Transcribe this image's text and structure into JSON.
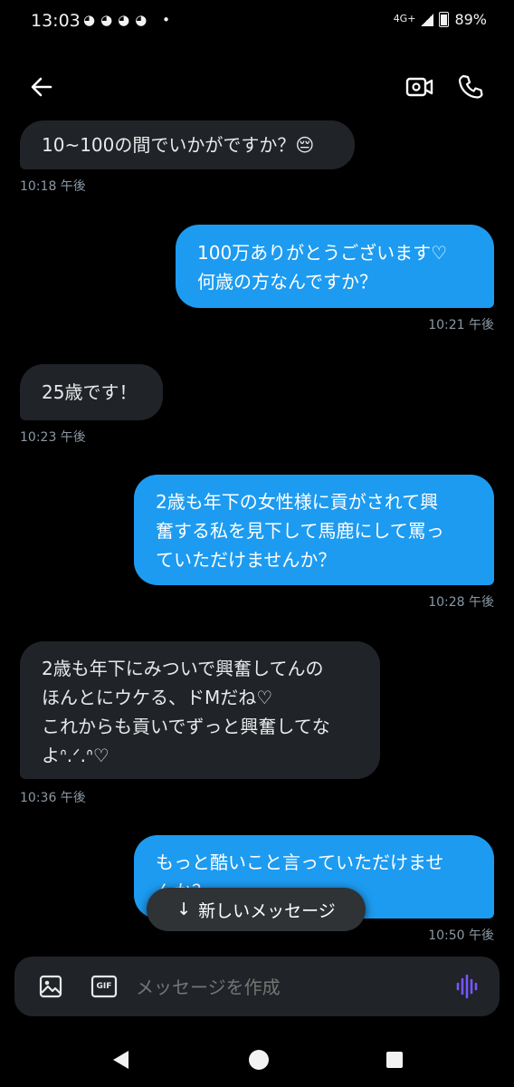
{
  "status": {
    "time": "13:03",
    "notif_icons": "◕◕◕◕ •",
    "network": "4G+",
    "battery": "89%"
  },
  "messages": [
    {
      "id": "m1",
      "side": "in",
      "lines": [
        "10~100の間でいかがですか？😔"
      ],
      "time": "10:18 午後"
    },
    {
      "id": "m2",
      "side": "out",
      "lines": [
        "100万ありがとうございます♡",
        "何歳の方なんですか？"
      ],
      "time": "10:21 午後"
    },
    {
      "id": "m3",
      "side": "in",
      "lines": [
        "25歳です！"
      ],
      "time": "10:23 午後"
    },
    {
      "id": "m4",
      "side": "out",
      "lines": [
        "2歳も年下の女性様に貢がされて興",
        "奮する私を見下して馬鹿にして罵っ",
        "ていただけませんか？"
      ],
      "time": "10:28 午後"
    },
    {
      "id": "m5",
      "side": "in",
      "lines": [
        "2歳も年下にみついで興奮してんの",
        "ほんとにウケる、ドMだね♡",
        "これからも貢いでずっと興奮してな",
        "よᐢ.ᐟ.ᐢ♡"
      ],
      "time": "10:36 午後"
    },
    {
      "id": "m6",
      "side": "out",
      "lines": [
        "もっと酷いこと言っていただけませ",
        "んか？"
      ],
      "time": "10:50 午後"
    }
  ],
  "new_messages_pill": {
    "arrow": "↓",
    "label": "新しいメッセージ"
  },
  "composer": {
    "placeholder": "メッセージを作成",
    "gif_label": "GIF"
  },
  "colors": {
    "outgoing": "#1d9bf0",
    "incoming": "#202327",
    "voice_accent": "#7856ff"
  }
}
